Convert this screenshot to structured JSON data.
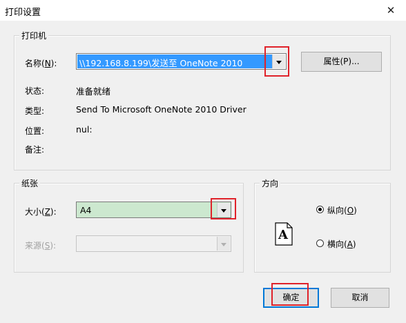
{
  "window": {
    "title": "打印设置",
    "close_glyph": "✕"
  },
  "printer_group": {
    "label": "打印机",
    "name_label": "名称(N):",
    "name_value": "\\\\192.168.8.199\\发送至 OneNote 2010",
    "properties_button": "属性(P)...",
    "status_label": "状态:",
    "status_value": "准备就绪",
    "type_label": "类型:",
    "type_value": "Send To Microsoft OneNote 2010 Driver",
    "location_label": "位置:",
    "location_value": "nul:",
    "comment_label": "备注:"
  },
  "paper_group": {
    "label": "纸张",
    "size_label": "大小(Z):",
    "size_value": "A4",
    "source_label": "来源(S):",
    "source_value": ""
  },
  "orientation_group": {
    "label": "方向",
    "portrait_label": "纵向(O)",
    "landscape_label": "横向(A)",
    "selected": "portrait",
    "page_icon_letter": "A"
  },
  "buttons": {
    "ok": "确定",
    "cancel": "取消"
  },
  "highlight_color": "#e0222a",
  "selection_color": "#3399ff"
}
